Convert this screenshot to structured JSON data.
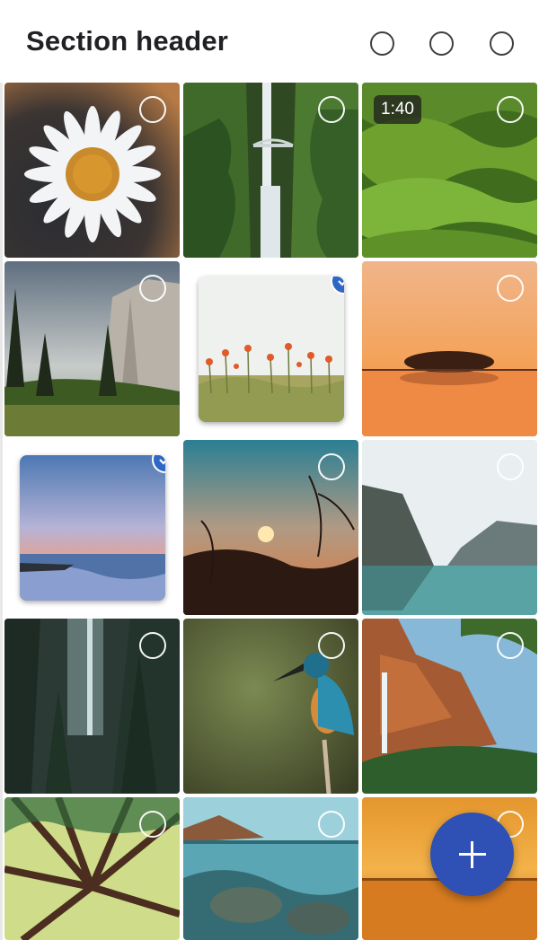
{
  "header": {
    "title": "Section header",
    "actions": [
      "header-action-1",
      "header-action-2",
      "header-action-3"
    ]
  },
  "tiles": [
    {
      "name": "daisy",
      "selected": false
    },
    {
      "name": "waterfall-bridge",
      "selected": false
    },
    {
      "name": "green-hills-video",
      "selected": false,
      "duration": "1:40"
    },
    {
      "name": "granite-cliff-forest",
      "selected": false
    },
    {
      "name": "poppy-field",
      "selected": true
    },
    {
      "name": "lake-island-sunset",
      "selected": false
    },
    {
      "name": "beach-sunset-clouds",
      "selected": true
    },
    {
      "name": "sunset-branches",
      "selected": false
    },
    {
      "name": "mountain-lake",
      "selected": false
    },
    {
      "name": "forest-waterfall",
      "selected": false
    },
    {
      "name": "kingfisher",
      "selected": false
    },
    {
      "name": "canyon-waterfall",
      "selected": false
    },
    {
      "name": "tree-canopy",
      "selected": false
    },
    {
      "name": "underwater-rocks",
      "selected": false
    },
    {
      "name": "ocean-sunset",
      "selected": false
    }
  ],
  "fab": {
    "icon": "plus-icon"
  },
  "colors": {
    "accent": "#2f67c6",
    "fab": "#2f50b5",
    "title": "#202124"
  }
}
